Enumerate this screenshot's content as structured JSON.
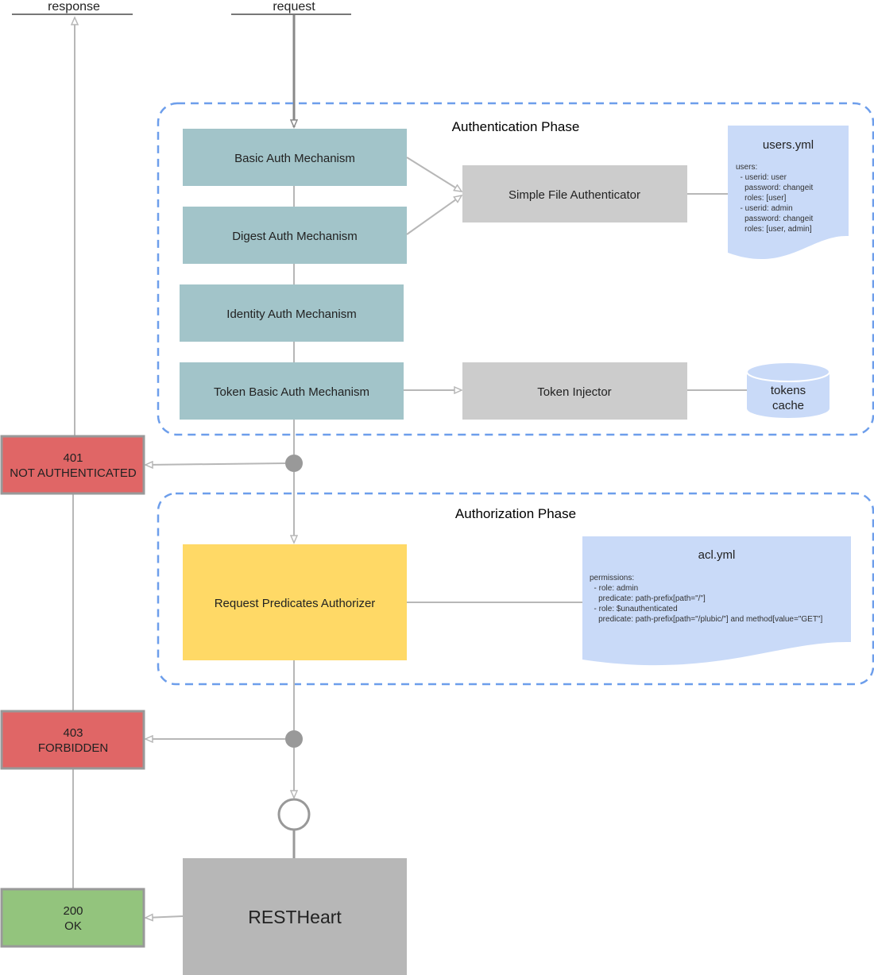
{
  "endpoints": {
    "response": "response",
    "request": "request"
  },
  "authentication": {
    "title": "Authentication Phase",
    "mechanisms": [
      "Basic Auth Mechanism",
      "Digest Auth Mechanism",
      "Identity Auth Mechanism",
      "Token Basic Auth Mechanism"
    ],
    "authenticator": "Simple File Authenticator",
    "token_injector": "Token Injector",
    "tokens_cache": [
      "tokens",
      "cache"
    ],
    "users_file": {
      "title": "users.yml",
      "lines": [
        "users:",
        "  - userid: user",
        "    password: changeit",
        "    roles: [user]",
        "  - userid: admin",
        "    password: changeit",
        "    roles: [user, admin]"
      ]
    }
  },
  "authorization": {
    "title": "Authorization Phase",
    "authorizer": "Request Predicates Authorizer",
    "acl_file": {
      "title": "acl.yml",
      "lines": [
        "permissions:",
        "  - role: admin",
        "    predicate: path-prefix[path=\"/\"]",
        "  - role: $unauthenticated",
        "    predicate: path-prefix[path=\"/plubic/\"] and method[value=\"GET\"]"
      ]
    }
  },
  "responses": {
    "not_authenticated": [
      "401",
      "NOT AUTHENTICATED"
    ],
    "forbidden": [
      "403",
      "FORBIDDEN"
    ],
    "ok": [
      "200",
      "OK"
    ]
  },
  "server": "RESTHeart",
  "colors": {
    "mechanism": "#a2c4c9",
    "component": "#cccccc",
    "file": "#c9daf8",
    "authorizer": "#ffd966",
    "error": "#e06666",
    "ok": "#93c47d",
    "server": "#b7b7b7",
    "phase_border": "#6d9eeb"
  }
}
